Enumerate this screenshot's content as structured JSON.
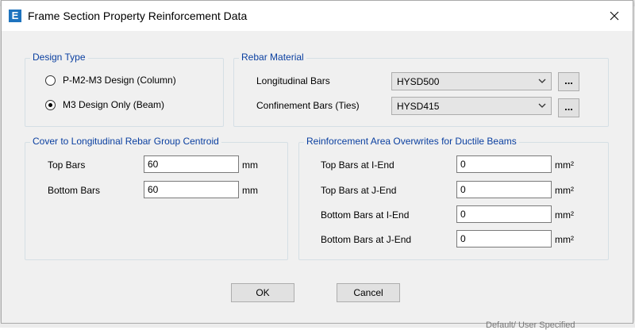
{
  "background": {
    "top_text": "...",
    "bottom_text": "Default/ User Specified"
  },
  "dialog": {
    "title": "Frame Section Property Reinforcement Data",
    "app_icon_letter": "E"
  },
  "design_type": {
    "legend": "Design Type",
    "options": [
      {
        "label": "P-M2-M3 Design  (Column)",
        "selected": false
      },
      {
        "label": "M3 Design Only  (Beam)",
        "selected": true
      }
    ]
  },
  "rebar_material": {
    "legend": "Rebar Material",
    "longitudinal": {
      "label": "Longitudinal Bars",
      "value": "HYSD500",
      "button": "..."
    },
    "confinement": {
      "label": "Confinement Bars (Ties)",
      "value": "HYSD415",
      "button": "..."
    }
  },
  "cover": {
    "legend": "Cover to Longitudinal Rebar Group Centroid",
    "top": {
      "label": "Top Bars",
      "value": "60",
      "unit": "mm"
    },
    "bottom": {
      "label": "Bottom  Bars",
      "value": "60",
      "unit": "mm"
    }
  },
  "overwrites": {
    "legend": "Reinforcement Area Overwrites for Ductile Beams",
    "rows": [
      {
        "label": "Top Bars at I-End",
        "value": "0",
        "unit": "mm²"
      },
      {
        "label": "Top Bars at J-End",
        "value": "0",
        "unit": "mm²"
      },
      {
        "label": "Bottom Bars at I-End",
        "value": "0",
        "unit": "mm²"
      },
      {
        "label": "Bottom Bars at J-End",
        "value": "0",
        "unit": "mm²"
      }
    ]
  },
  "buttons": {
    "ok": "OK",
    "cancel": "Cancel"
  },
  "colors": {
    "legend": "#0a3fa0",
    "dialog_bg": "#f0f0f0",
    "icon": "#1e73be"
  }
}
